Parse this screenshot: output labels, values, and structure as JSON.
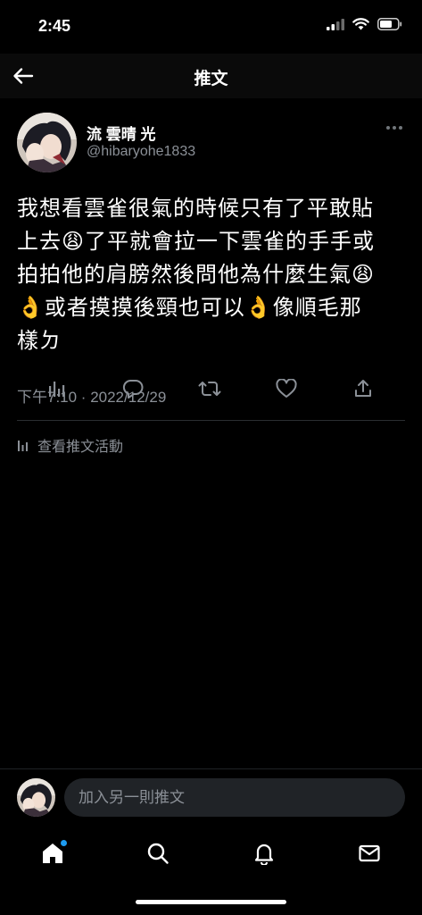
{
  "status_bar": {
    "time": "2:45"
  },
  "header": {
    "title": "推文",
    "back_icon": "arrow-left-icon"
  },
  "tweet": {
    "author_name": "流 雲晴 光",
    "author_handle": "@hibaryohe1833",
    "text": "我想看雲雀很氣的時候只有了平敢貼\n上去😩了平就會拉一下雲雀的手手或\n拍拍他的肩膀然後問他為什麼生氣😩\n👌或者摸摸後頸也可以👌像順毛那\n樣ㄉ",
    "timestamp": "下午7:10 · 2022/12/29",
    "activity_label": "查看推文活動"
  },
  "actions": [
    "analytics-icon",
    "reply-icon",
    "retweet-icon",
    "like-icon",
    "share-icon"
  ],
  "reply": {
    "placeholder": "加入另一則推文"
  },
  "tabs": [
    "home-icon",
    "search-icon",
    "notifications-icon",
    "messages-icon"
  ],
  "colors": {
    "background": "#000000",
    "secondary_text": "#8b9097",
    "accent": "#1d9bf0",
    "input_bg": "#202327"
  }
}
